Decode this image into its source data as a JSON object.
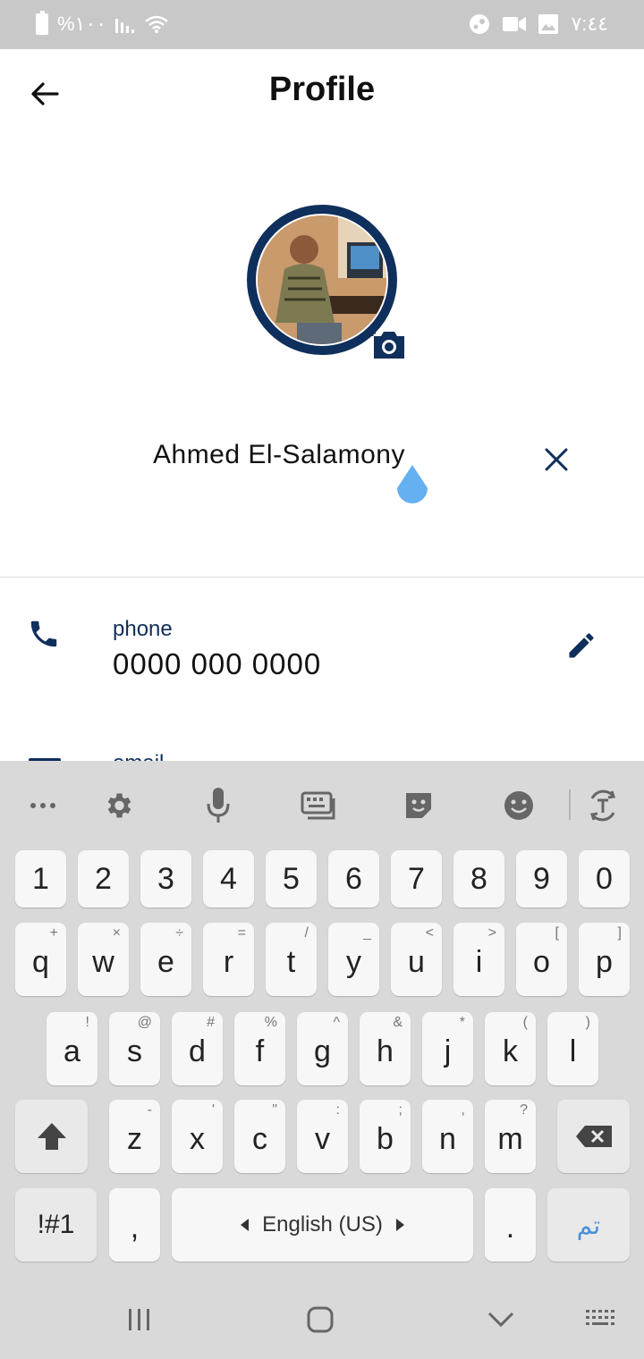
{
  "status_bar": {
    "left_text": "%١٠٠",
    "time": "٧:٤٤"
  },
  "header": {
    "title": "Profile"
  },
  "profile": {
    "name": "Ahmed El-Salamony"
  },
  "phone": {
    "label": "phone",
    "value": "0000 000 0000"
  },
  "next_field": {
    "label": "email"
  },
  "keyboard": {
    "number_row": [
      "1",
      "2",
      "3",
      "4",
      "5",
      "6",
      "7",
      "8",
      "9",
      "0"
    ],
    "row1": [
      {
        "key": "q",
        "hint": "+"
      },
      {
        "key": "w",
        "hint": "×"
      },
      {
        "key": "e",
        "hint": "÷"
      },
      {
        "key": "r",
        "hint": "="
      },
      {
        "key": "t",
        "hint": "/"
      },
      {
        "key": "y",
        "hint": "_"
      },
      {
        "key": "u",
        "hint": "<"
      },
      {
        "key": "i",
        "hint": ">"
      },
      {
        "key": "o",
        "hint": "["
      },
      {
        "key": "p",
        "hint": "]"
      }
    ],
    "row2": [
      {
        "key": "a",
        "hint": "!"
      },
      {
        "key": "s",
        "hint": "@"
      },
      {
        "key": "d",
        "hint": "#"
      },
      {
        "key": "f",
        "hint": "%"
      },
      {
        "key": "g",
        "hint": "^"
      },
      {
        "key": "h",
        "hint": "&"
      },
      {
        "key": "j",
        "hint": "*"
      },
      {
        "key": "k",
        "hint": "("
      },
      {
        "key": "l",
        "hint": ")"
      }
    ],
    "row3": [
      {
        "key": "z",
        "hint": "-"
      },
      {
        "key": "x",
        "hint": "'"
      },
      {
        "key": "c",
        "hint": "\""
      },
      {
        "key": "v",
        "hint": ":"
      },
      {
        "key": "b",
        "hint": ";"
      },
      {
        "key": "n",
        "hint": ","
      },
      {
        "key": "m",
        "hint": "?"
      }
    ],
    "symbols_label": "!#1",
    "comma_label": ",",
    "space_label": "English (US)",
    "period_label": ".",
    "done_label": "تم",
    "accent_color": "#4a90d9"
  },
  "colors": {
    "brand": "#0f2f5c",
    "handle": "#64b0f0",
    "status_bar_bg": "#c8c8c8",
    "keyboard_bg": "#d9d9d9"
  },
  "icons": {
    "back": "arrow-left-icon",
    "camera": "camera-icon",
    "clear": "close-icon",
    "phone": "phone-icon",
    "edit": "pencil-icon"
  }
}
